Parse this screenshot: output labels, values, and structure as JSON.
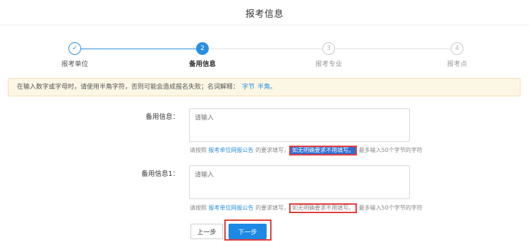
{
  "page_title": "报考信息",
  "steps": [
    {
      "icon": "✓",
      "label": "报考单位",
      "state": "done"
    },
    {
      "icon": "2",
      "label": "备用信息",
      "state": "current"
    },
    {
      "icon": "3",
      "label": "报考专业",
      "state": "pending"
    },
    {
      "icon": "4",
      "label": "报考点",
      "state": "pending"
    }
  ],
  "notice": {
    "text": "在输入数字或字母时，请使用半角字符，否则可能会造成报名失败；名词解释：",
    "link1": "字节",
    "link2": "半角。"
  },
  "fields": [
    {
      "label": "备用信息：",
      "placeholder": "请输入",
      "help_prefix": "请按照",
      "help_link": "报考单位网报公告",
      "help_mid": "的要求填写，",
      "help_emphasis": "如无明确要求不用填写。",
      "help_suffix": "最多输入50个字节的字符"
    },
    {
      "label": "备用信息1：",
      "placeholder": "请输入",
      "help_prefix": "请按照",
      "help_link": "报考单位网报公告",
      "help_mid": "的要求填写，",
      "help_emphasis": "如无明确要求不用填写。",
      "help_suffix": "最多输入50个字节的字符"
    }
  ],
  "buttons": {
    "prev": "上一步",
    "next": "下一步"
  },
  "colors": {
    "accent": "#2b8fe0",
    "highlight_box": "#e23d3d",
    "notice_bg": "#fcf6e5"
  }
}
